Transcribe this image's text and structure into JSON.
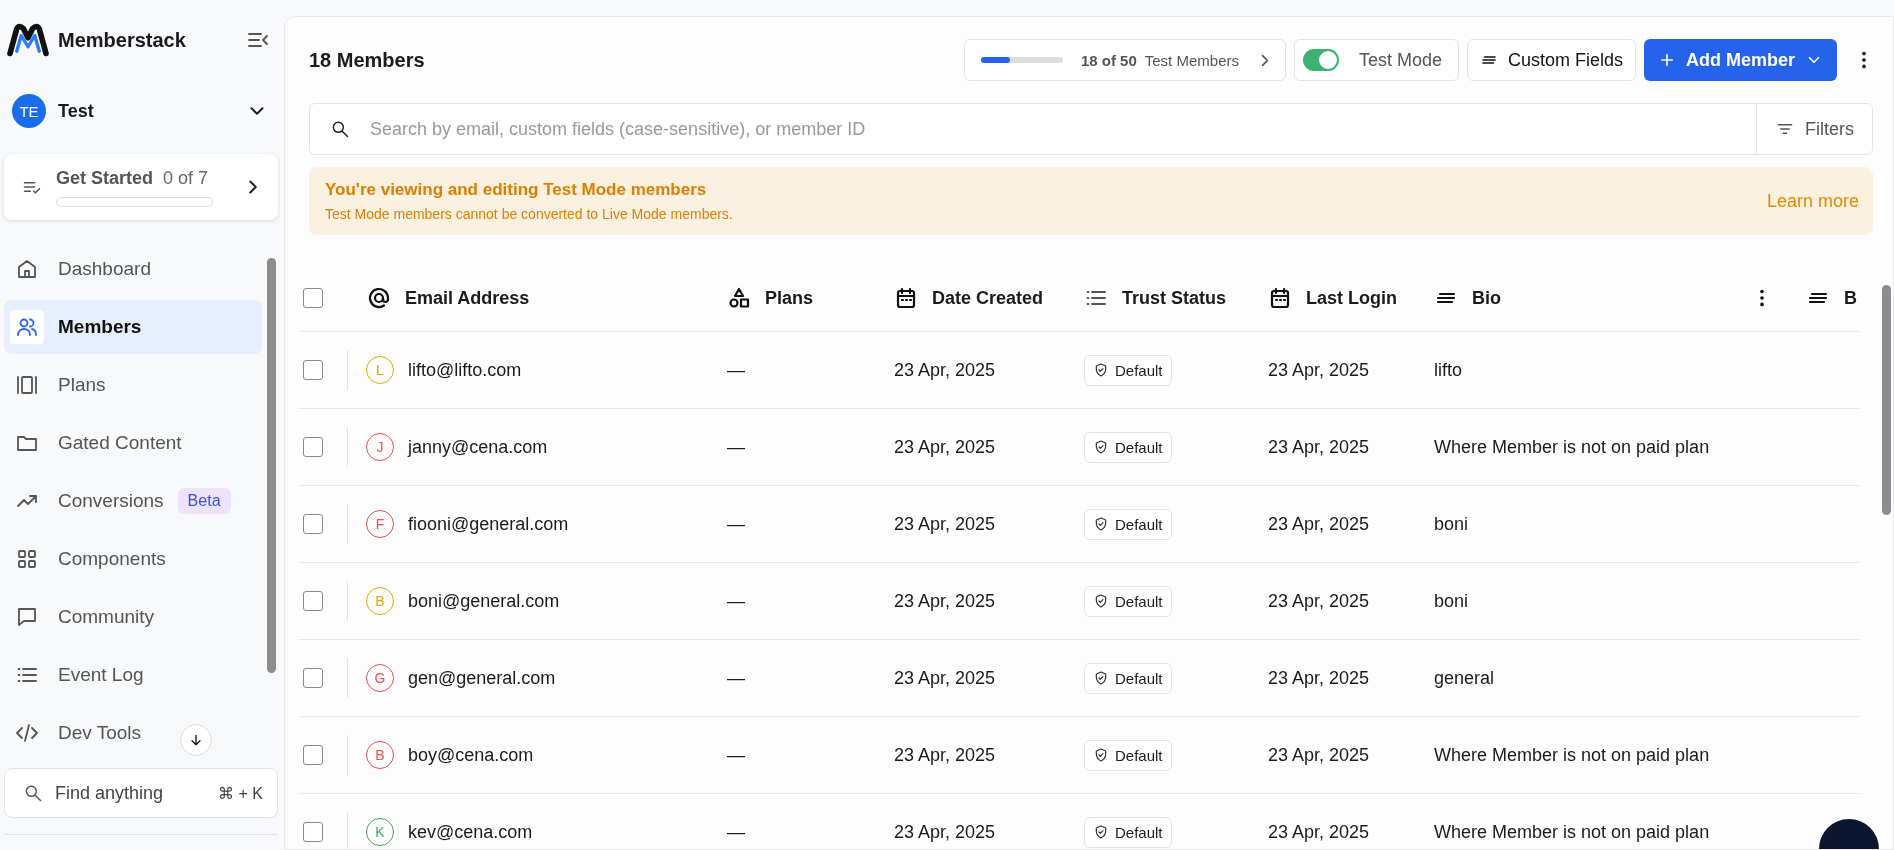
{
  "sidebar": {
    "brand": "Memberstack",
    "workspace": {
      "initials": "TE",
      "name": "Test"
    },
    "get_started": {
      "label": "Get Started",
      "count": "0 of 7",
      "level": 0
    },
    "items": [
      {
        "label": "Dashboard",
        "selected": false
      },
      {
        "label": "Members",
        "selected": true
      },
      {
        "label": "Plans",
        "selected": false
      },
      {
        "label": "Gated Content",
        "selected": false
      },
      {
        "label": "Conversions",
        "selected": false,
        "badge": "Beta"
      },
      {
        "label": "Components",
        "selected": false
      },
      {
        "label": "Community",
        "selected": false
      },
      {
        "label": "Event Log",
        "selected": false
      },
      {
        "label": "Dev Tools",
        "selected": false
      }
    ],
    "search": {
      "placeholder": "Find anything",
      "shortcut": "⌘ + K"
    }
  },
  "header": {
    "title": "18 Members",
    "usage": {
      "count": "18 of 50",
      "label": "Test Members",
      "level": 0.36
    },
    "test_mode": {
      "label": "Test Mode",
      "on": true
    },
    "custom_fields": "Custom Fields",
    "add_member": "Add Member"
  },
  "search": {
    "placeholder": "Search by email, custom fields (case-sensitive), or member ID",
    "filters": "Filters"
  },
  "banner": {
    "title": "You're viewing and editing Test Mode members",
    "text": "Test Mode members cannot be converted to Live Mode members.",
    "link": "Learn more"
  },
  "table": {
    "select_all_checked": false,
    "columns": [
      {
        "label": "Email Address"
      },
      {
        "label": "Plans"
      },
      {
        "label": "Date Created"
      },
      {
        "label": "Trust Status"
      },
      {
        "label": "Last Login"
      },
      {
        "label": "Bio"
      },
      {
        "label": "B"
      }
    ],
    "rows": [
      {
        "checked": false,
        "initial": "L",
        "color": "#e6a700",
        "email": "lifto@lifto.com",
        "plans": "—",
        "created": "23 Apr, 2025",
        "trust": "Default",
        "last_login": "23 Apr, 2025",
        "bio": "lifto"
      },
      {
        "checked": false,
        "initial": "J",
        "color": "#e5534b",
        "email": "janny@cena.com",
        "plans": "—",
        "created": "23 Apr, 2025",
        "trust": "Default",
        "last_login": "23 Apr, 2025",
        "bio": "Where Member is not on paid plan"
      },
      {
        "checked": false,
        "initial": "F",
        "color": "#e5534b",
        "email": "fiooni@general.com",
        "plans": "—",
        "created": "23 Apr, 2025",
        "trust": "Default",
        "last_login": "23 Apr, 2025",
        "bio": "boni"
      },
      {
        "checked": false,
        "initial": "B",
        "color": "#e6a700",
        "email": "boni@general.com",
        "plans": "—",
        "created": "23 Apr, 2025",
        "trust": "Default",
        "last_login": "23 Apr, 2025",
        "bio": "boni"
      },
      {
        "checked": false,
        "initial": "G",
        "color": "#e5534b",
        "email": "gen@general.com",
        "plans": "—",
        "created": "23 Apr, 2025",
        "trust": "Default",
        "last_login": "23 Apr, 2025",
        "bio": "general"
      },
      {
        "checked": false,
        "initial": "B",
        "color": "#e5534b",
        "email": "boy@cena.com",
        "plans": "—",
        "created": "23 Apr, 2025",
        "trust": "Default",
        "last_login": "23 Apr, 2025",
        "bio": "Where Member is not on paid plan"
      },
      {
        "checked": false,
        "initial": "K",
        "color": "#3aa757",
        "email": "kev@cena.com",
        "plans": "—",
        "created": "23 Apr, 2025",
        "trust": "Default",
        "last_login": "23 Apr, 2025",
        "bio": "Where Member is not on paid plan"
      }
    ]
  }
}
